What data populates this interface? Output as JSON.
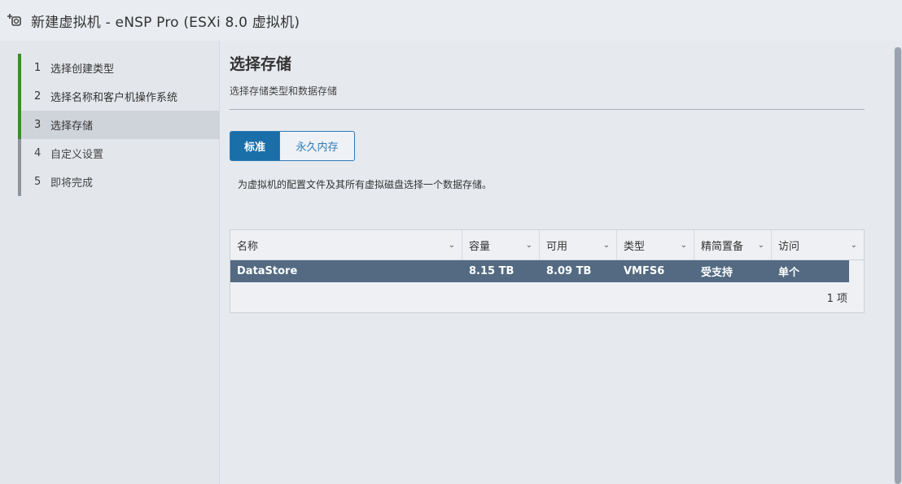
{
  "window": {
    "icon": "add-vm-icon",
    "title": "新建虚拟机 - eNSP Pro (ESXi 8.0 虚拟机)"
  },
  "steps": [
    {
      "num": "1",
      "label": "选择创建类型",
      "state": "done"
    },
    {
      "num": "2",
      "label": "选择名称和客户机操作系统",
      "state": "done"
    },
    {
      "num": "3",
      "label": "选择存储",
      "state": "active"
    },
    {
      "num": "4",
      "label": "自定义设置",
      "state": "pending"
    },
    {
      "num": "5",
      "label": "即将完成",
      "state": "pending"
    }
  ],
  "main": {
    "title": "选择存储",
    "subtitle": "选择存储类型和数据存储",
    "toggle": {
      "standard": "标准",
      "persistent": "永久内存"
    },
    "description": "为虚拟机的配置文件及其所有虚拟磁盘选择一个数据存储。",
    "table": {
      "columns": [
        "名称",
        "容量",
        "可用",
        "类型",
        "精简置备",
        "访问"
      ],
      "rows": [
        [
          "DataStore",
          "8.15 TB",
          "8.09 TB",
          "VMFS6",
          "受支持",
          "单个"
        ]
      ],
      "footer": "1 项"
    }
  },
  "colors": {
    "accent": "#1b6fa8",
    "step_done": "#3f8a2d",
    "selected_row": "#536a82"
  }
}
